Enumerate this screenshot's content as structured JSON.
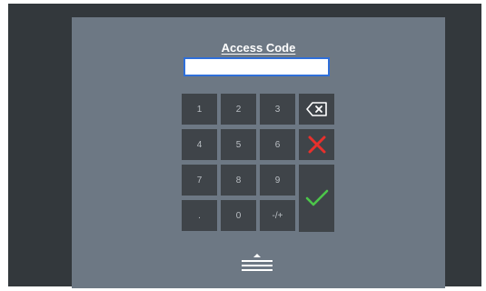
{
  "dialog": {
    "title": "Access Code",
    "code_value": "",
    "code_placeholder": ""
  },
  "keypad": {
    "keys": [
      {
        "id": "1",
        "label": "1"
      },
      {
        "id": "2",
        "label": "2"
      },
      {
        "id": "3",
        "label": "3"
      },
      {
        "id": "4",
        "label": "4"
      },
      {
        "id": "5",
        "label": "5"
      },
      {
        "id": "6",
        "label": "6"
      },
      {
        "id": "7",
        "label": "7"
      },
      {
        "id": "8",
        "label": "8"
      },
      {
        "id": "9",
        "label": "9"
      },
      {
        "id": "decimal",
        "label": "."
      },
      {
        "id": "0",
        "label": "0"
      },
      {
        "id": "sign",
        "label": "-/+"
      }
    ],
    "backspace_icon": "backspace-icon",
    "clear_icon": "close-icon",
    "enter_icon": "checkmark-icon"
  },
  "footer": {
    "collapse_icon": "eject-icon"
  },
  "colors": {
    "panel": "#6d7884",
    "background": "#33383c",
    "key": "#3f4449",
    "key_text": "#b9bec3",
    "input_border": "#2f6fd9",
    "clear_red": "#e8302c",
    "confirm_green": "#4cc64a"
  }
}
